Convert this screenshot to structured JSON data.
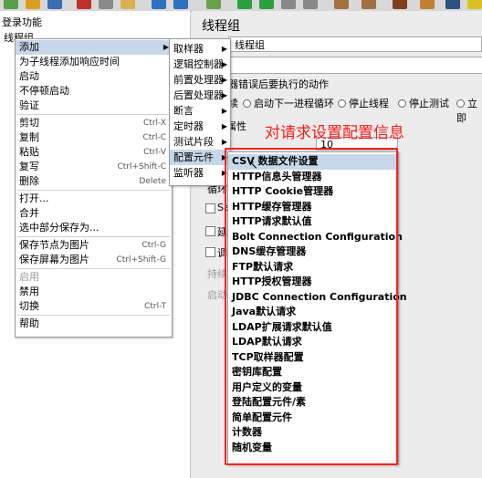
{
  "tree": {
    "root_label": "登录功能",
    "selected_node": "线程组"
  },
  "right_panel": {
    "title": "线程组",
    "name_value": "线程组",
    "error_action_label": "器错误后要执行的动作",
    "radio_options": [
      "续",
      "启动下一进程循环",
      "停止线程",
      "停止测试",
      "立即"
    ],
    "properties_label": "属性",
    "num_threads_value": "10",
    "loop_label": "循环",
    "checkbox_labels": [
      "Sa",
      "延",
      "调"
    ],
    "gray_labels": [
      "持续",
      "启动"
    ]
  },
  "context_menu": {
    "items": [
      {
        "label": "添加",
        "arrow": true,
        "highlight": true
      },
      {
        "label": "为子线程添加响应时间"
      },
      {
        "label": "启动"
      },
      {
        "label": "不停顿启动"
      },
      {
        "label": "验证"
      },
      {
        "sep": true
      },
      {
        "label": "剪切",
        "shortcut": "Ctrl-X"
      },
      {
        "label": "复制",
        "shortcut": "Ctrl-C"
      },
      {
        "label": "粘贴",
        "shortcut": "Ctrl-V"
      },
      {
        "label": "复写",
        "shortcut": "Ctrl+Shift-C"
      },
      {
        "label": "删除",
        "shortcut": "Delete"
      },
      {
        "sep": true
      },
      {
        "label": "打开..."
      },
      {
        "label": "合并"
      },
      {
        "label": "选中部分保存为..."
      },
      {
        "sep": true
      },
      {
        "label": "保存节点为图片",
        "shortcut": "Ctrl-G"
      },
      {
        "label": "保存屏幕为图片",
        "shortcut": "Ctrl+Shift-G"
      },
      {
        "sep": true
      },
      {
        "label": "启用",
        "disabled": true
      },
      {
        "label": "禁用"
      },
      {
        "label": "切换",
        "shortcut": "Ctrl-T"
      },
      {
        "sep": true
      },
      {
        "label": "帮助"
      }
    ]
  },
  "add_submenu": {
    "items": [
      {
        "label": "取样器"
      },
      {
        "label": "逻辑控制器"
      },
      {
        "label": "前置处理器"
      },
      {
        "label": "后置处理器"
      },
      {
        "label": "断言"
      },
      {
        "label": "定时器"
      },
      {
        "label": "测试片段"
      },
      {
        "label": "配置元件",
        "highlight": true
      },
      {
        "label": "监听器"
      }
    ]
  },
  "config_submenu": {
    "items": [
      {
        "label": "CSV 数据文件设置",
        "highlight": true
      },
      {
        "label": "HTTP信息头管理器"
      },
      {
        "label": "HTTP Cookie管理器"
      },
      {
        "label": "HTTP缓存管理器"
      },
      {
        "label": "HTTP请求默认值"
      },
      {
        "label": "Bolt Connection Configuration"
      },
      {
        "label": "DNS缓存管理器"
      },
      {
        "label": "FTP默认请求"
      },
      {
        "label": "HTTP授权管理器"
      },
      {
        "label": "JDBC Connection Configuration"
      },
      {
        "label": "Java默认请求"
      },
      {
        "label": "LDAP扩展请求默认值"
      },
      {
        "label": "LDAP默认请求"
      },
      {
        "label": "TCP取样器配置"
      },
      {
        "label": "密钥库配置"
      },
      {
        "label": "用户定义的变量"
      },
      {
        "label": "登陆配置元件/素"
      },
      {
        "label": "简单配置元件"
      },
      {
        "label": "计数器"
      },
      {
        "label": "随机变量"
      }
    ]
  },
  "annotation": {
    "text": "对请求设置配置信息",
    "color": "#ff1a1a"
  }
}
